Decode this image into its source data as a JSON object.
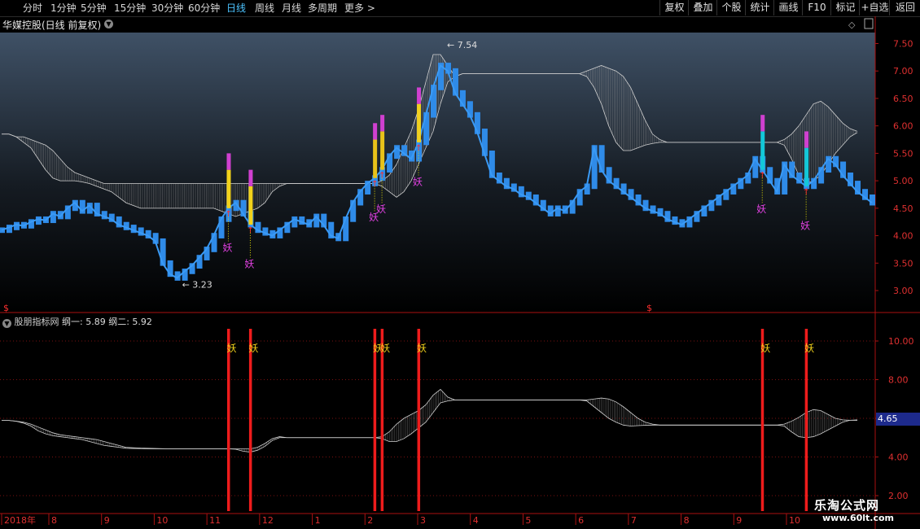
{
  "toolbar": {
    "periods": [
      "分时",
      "1分钟",
      "5分钟",
      "15分钟",
      "30分钟",
      "60分钟",
      "日线",
      "周线",
      "月线",
      "多周期",
      "更多 >"
    ],
    "active_period": "日线",
    "buttons": [
      "复权",
      "叠加",
      "个股",
      "统计",
      "画线",
      "F10",
      "标记",
      "+自选",
      "返回"
    ]
  },
  "main": {
    "title": "华媒控股(日线 前复权)",
    "top_icon": "diamond-icon",
    "s_markers": [
      "$",
      "$"
    ]
  },
  "indicator": {
    "name": "股朋指标网",
    "v1_label": "纲一: 5.89",
    "v2_label": "纲二: 5.92",
    "price_tag": "4.65"
  },
  "watermark": {
    "line1": "乐淘公式网",
    "line2": "www.60lt.com"
  },
  "chart_data": [
    {
      "type": "line",
      "title": "华媒控股(日线 前复权)",
      "ylim": [
        2.6,
        7.7
      ],
      "y_ticks": [
        "7.50",
        "7.00",
        "6.50",
        "6.00",
        "5.50",
        "5.00",
        "4.50",
        "4.00",
        "3.50",
        "3.00"
      ],
      "x_ticks": [
        "2018年",
        "8",
        "9",
        "10",
        "11",
        "12",
        "1",
        "2",
        "3",
        "4",
        "5",
        "6",
        "7",
        "8",
        "9",
        "10"
      ],
      "annotations": {
        "high_label": "7.54",
        "low_label": "3.23",
        "signal_label": "妖"
      },
      "close": [
        4.1,
        4.15,
        4.2,
        4.18,
        4.25,
        4.3,
        4.28,
        4.4,
        4.35,
        4.5,
        4.6,
        4.45,
        4.55,
        4.4,
        4.35,
        4.3,
        4.2,
        4.15,
        4.1,
        4.05,
        4.0,
        3.9,
        3.5,
        3.3,
        3.23,
        3.35,
        3.45,
        3.6,
        3.75,
        4.0,
        4.3,
        4.5,
        4.6,
        4.4,
        4.2,
        4.1,
        4.05,
        4.0,
        4.1,
        4.2,
        4.3,
        4.25,
        4.2,
        4.35,
        4.2,
        4.0,
        3.95,
        4.3,
        4.6,
        4.8,
        4.95,
        5.05,
        5.2,
        5.45,
        5.6,
        5.5,
        5.4,
        5.7,
        6.2,
        6.7,
        7.1,
        7.0,
        6.6,
        6.4,
        6.2,
        5.9,
        5.5,
        5.1,
        5.0,
        4.9,
        4.85,
        4.75,
        4.7,
        4.6,
        4.5,
        4.4,
        4.5,
        4.45,
        4.6,
        4.8,
        4.9,
        5.6,
        5.2,
        5.0,
        4.9,
        4.8,
        4.7,
        4.6,
        4.5,
        4.45,
        4.4,
        4.3,
        4.25,
        4.2,
        4.3,
        4.4,
        4.5,
        4.6,
        4.7,
        4.8,
        4.9,
        5.0,
        5.1,
        5.4,
        5.2,
        5.0,
        4.8,
        5.3,
        5.1,
        5.0,
        4.9,
        5.0,
        5.2,
        5.4,
        5.3,
        5.1,
        4.95,
        4.8,
        4.7,
        4.6
      ],
      "band_upper": [
        5.85,
        5.85,
        5.8,
        5.8,
        5.75,
        5.7,
        5.65,
        5.55,
        5.4,
        5.25,
        5.15,
        5.1,
        5.05,
        5.0,
        4.95,
        4.95,
        4.95,
        4.95,
        4.95,
        4.95,
        4.95,
        4.95,
        4.95,
        4.95,
        4.95,
        4.95,
        4.95,
        4.95,
        4.95,
        4.95,
        4.95,
        4.95,
        4.95,
        4.95,
        4.95,
        4.95,
        4.95,
        4.95,
        4.95,
        4.95,
        4.95,
        4.95,
        4.95,
        4.95,
        4.95,
        4.95,
        4.95,
        4.95,
        4.95,
        4.95,
        4.95,
        4.95,
        5.0,
        5.1,
        5.3,
        5.6,
        5.9,
        6.3,
        6.8,
        7.3,
        7.3,
        7.1,
        6.9,
        6.95,
        6.95,
        6.95,
        6.95,
        6.95,
        6.95,
        6.95,
        6.95,
        6.95,
        6.95,
        6.95,
        6.95,
        6.95,
        6.95,
        6.95,
        6.95,
        6.95,
        7.0,
        7.05,
        7.1,
        7.05,
        7.0,
        6.9,
        6.7,
        6.4,
        6.1,
        5.85,
        5.75,
        5.7,
        5.7,
        5.7,
        5.7,
        5.7,
        5.7,
        5.7,
        5.7,
        5.7,
        5.7,
        5.7,
        5.7,
        5.7,
        5.7,
        5.7,
        5.7,
        5.75,
        5.85,
        6.0,
        6.2,
        6.4,
        6.45,
        6.35,
        6.2,
        6.05,
        5.95,
        5.9
      ],
      "band_lower": [
        5.85,
        5.85,
        5.8,
        5.7,
        5.6,
        5.4,
        5.2,
        5.05,
        5.0,
        5.0,
        5.0,
        4.98,
        4.95,
        4.9,
        4.85,
        4.8,
        4.7,
        4.6,
        4.55,
        4.5,
        4.5,
        4.5,
        4.5,
        4.5,
        4.5,
        4.5,
        4.5,
        4.5,
        4.5,
        4.5,
        4.45,
        4.4,
        4.35,
        4.4,
        4.45,
        4.5,
        4.6,
        4.8,
        4.9,
        4.95,
        4.95,
        4.95,
        4.95,
        4.95,
        4.95,
        4.95,
        4.95,
        4.95,
        4.95,
        4.95,
        4.95,
        4.95,
        4.9,
        4.8,
        4.7,
        4.8,
        5.0,
        5.3,
        5.6,
        5.9,
        6.4,
        6.8,
        6.9,
        6.95,
        6.95,
        6.95,
        6.95,
        6.95,
        6.95,
        6.95,
        6.95,
        6.95,
        6.95,
        6.95,
        6.95,
        6.95,
        6.95,
        6.95,
        6.95,
        6.95,
        6.9,
        6.7,
        6.4,
        6.0,
        5.7,
        5.55,
        5.55,
        5.6,
        5.65,
        5.68,
        5.7,
        5.7,
        5.7,
        5.7,
        5.7,
        5.7,
        5.7,
        5.7,
        5.7,
        5.7,
        5.7,
        5.7,
        5.7,
        5.7,
        5.7,
        5.7,
        5.7,
        5.65,
        5.4,
        5.1,
        4.95,
        5.0,
        5.1,
        5.3,
        5.5,
        5.65,
        5.8,
        5.88
      ],
      "signal_index": [
        31,
        34,
        51,
        52,
        57,
        104,
        110
      ]
    },
    {
      "type": "line",
      "title": "股朋指标网",
      "ylim": [
        1.2,
        10.8
      ],
      "y_ticks": [
        "10.00",
        "8.00",
        "6.00",
        "4.00",
        "2.00"
      ],
      "signal_label": "妖",
      "line1": [
        5.89,
        5.89,
        5.85,
        5.8,
        5.7,
        5.55,
        5.4,
        5.25,
        5.15,
        5.1,
        5.05,
        5.0,
        4.95,
        4.9,
        4.8,
        4.7,
        4.6,
        4.5,
        4.48,
        4.46,
        4.45,
        4.44,
        4.43,
        4.42,
        4.42,
        4.42,
        4.42,
        4.42,
        4.42,
        4.42,
        4.42,
        4.42,
        4.42,
        4.42,
        4.42,
        4.5,
        4.7,
        4.95,
        5.05,
        5.0,
        5.0,
        5.0,
        5.0,
        5.0,
        5.0,
        5.0,
        5.0,
        5.0,
        5.0,
        5.0,
        5.0,
        5.0,
        5.05,
        5.3,
        5.7,
        6.0,
        6.2,
        6.4,
        6.7,
        7.2,
        7.5,
        7.1,
        6.95,
        6.95,
        6.95,
        6.95,
        6.95,
        6.95,
        6.95,
        6.95,
        6.95,
        6.95,
        6.95,
        6.95,
        6.95,
        6.95,
        6.95,
        6.95,
        6.95,
        6.95,
        6.95,
        7.0,
        7.05,
        7.0,
        6.85,
        6.6,
        6.3,
        6.0,
        5.8,
        5.7,
        5.65,
        5.65,
        5.65,
        5.65,
        5.65,
        5.65,
        5.65,
        5.65,
        5.65,
        5.65,
        5.65,
        5.65,
        5.65,
        5.65,
        5.65,
        5.65,
        5.65,
        5.7,
        5.85,
        6.05,
        6.3,
        6.45,
        6.4,
        6.2,
        6.0,
        5.92,
        5.9,
        5.89
      ],
      "line2": [
        5.89,
        5.89,
        5.85,
        5.75,
        5.6,
        5.35,
        5.2,
        5.1,
        5.05,
        5.0,
        4.95,
        4.9,
        4.8,
        4.7,
        4.6,
        4.55,
        4.5,
        4.45,
        4.44,
        4.43,
        4.42,
        4.42,
        4.42,
        4.42,
        4.42,
        4.42,
        4.42,
        4.42,
        4.42,
        4.42,
        4.42,
        4.42,
        4.4,
        4.3,
        4.25,
        4.35,
        4.55,
        4.85,
        5.0,
        5.0,
        5.0,
        5.0,
        5.0,
        5.0,
        5.0,
        5.0,
        5.0,
        5.0,
        5.0,
        5.0,
        5.0,
        5.0,
        4.95,
        4.8,
        4.8,
        4.95,
        5.2,
        5.5,
        5.8,
        6.3,
        6.8,
        6.9,
        6.95,
        6.95,
        6.95,
        6.95,
        6.95,
        6.95,
        6.95,
        6.95,
        6.95,
        6.95,
        6.95,
        6.95,
        6.95,
        6.95,
        6.95,
        6.95,
        6.95,
        6.95,
        6.9,
        6.6,
        6.3,
        6.0,
        5.8,
        5.65,
        5.6,
        5.62,
        5.64,
        5.65,
        5.65,
        5.65,
        5.65,
        5.65,
        5.65,
        5.65,
        5.65,
        5.65,
        5.65,
        5.65,
        5.65,
        5.65,
        5.65,
        5.65,
        5.65,
        5.65,
        5.65,
        5.6,
        5.3,
        5.05,
        5.0,
        5.05,
        5.2,
        5.4,
        5.6,
        5.8,
        5.9,
        5.92
      ],
      "signal_index": [
        31,
        34,
        51,
        52,
        57,
        104,
        110
      ]
    }
  ]
}
